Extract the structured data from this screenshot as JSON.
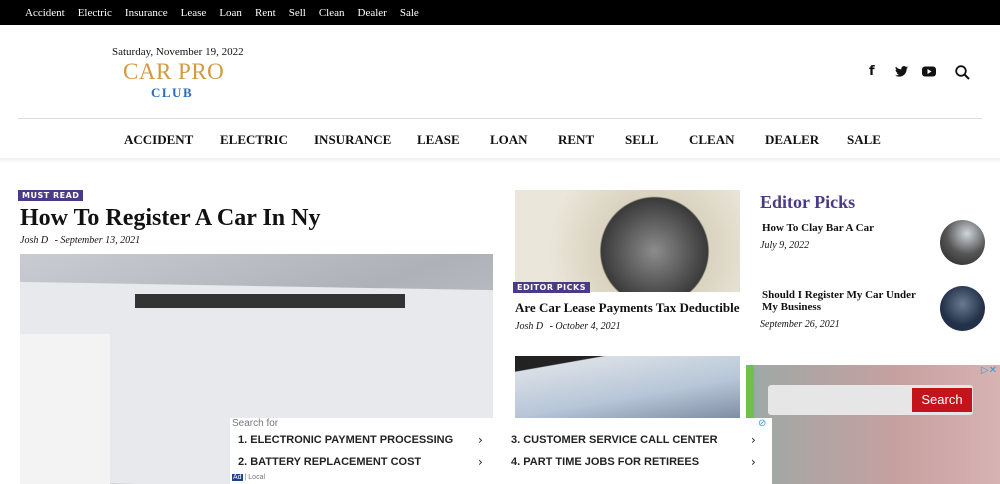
{
  "topnav": [
    "Accident",
    "Electric",
    "Insurance",
    "Lease",
    "Loan",
    "Rent",
    "Sell",
    "Clean",
    "Dealer",
    "Sale"
  ],
  "header": {
    "date": "Saturday, November 19, 2022",
    "logo_top": "CAR PRO",
    "logo_bottom": "CLUB",
    "icons": [
      "facebook-icon",
      "twitter-icon",
      "youtube-icon",
      "search-icon"
    ]
  },
  "mainnav": [
    "ACCIDENT",
    "ELECTRIC",
    "INSURANCE",
    "LEASE",
    "LOAN",
    "RENT",
    "SELL",
    "CLEAN",
    "DEALER",
    "SALE"
  ],
  "featured": {
    "badge": "MUST READ",
    "title": "How To Register A Car In Ny",
    "author": "Josh D",
    "date": "- September 13, 2021"
  },
  "middle": {
    "badge": "EDITOR PICKS",
    "title": "Are Car Lease Payments Tax Deductible",
    "author": "Josh D",
    "date": "- October 4, 2021"
  },
  "editor_picks": {
    "heading": "Editor Picks",
    "items": [
      {
        "title": "How To Clay Bar A Car",
        "date": "July 9, 2022"
      },
      {
        "title": "Should I Register My Car Under My Business",
        "date": "September 26, 2021"
      }
    ]
  },
  "ad": {
    "search_for": "Search for",
    "items": [
      "1. ELECTRONIC PAYMENT PROCESSING",
      "2. BATTERY REPLACEMENT COST",
      "3. CUSTOMER SERVICE CALL CENTER",
      "4. PART TIME JOBS FOR RETIREES"
    ],
    "footer": "| Local",
    "ad_label": "Ad"
  },
  "side_ad": {
    "button": "Search"
  },
  "colors": {
    "accent": "#4b3b87",
    "logo_gold": "#d4983f",
    "logo_blue": "#2a6db5",
    "ad_red": "#c4141b"
  }
}
